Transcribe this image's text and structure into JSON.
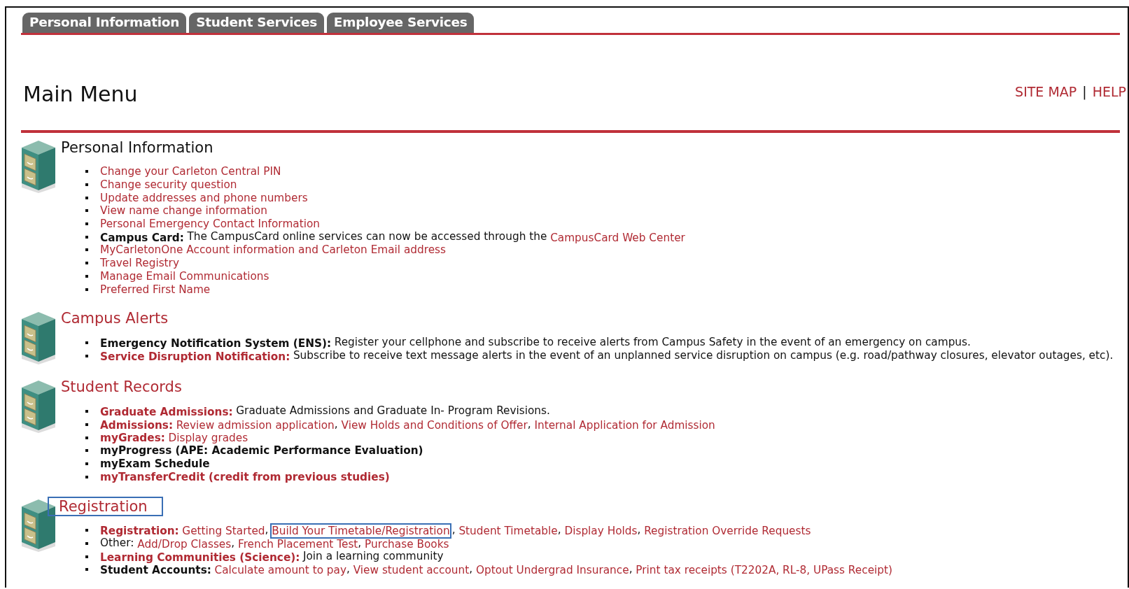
{
  "tabs": [
    {
      "label": "Personal Information"
    },
    {
      "label": "Student Services"
    },
    {
      "label": "Employee Services"
    }
  ],
  "page_title": "Main Menu",
  "header_links": [
    {
      "label": "SITE MAP"
    },
    {
      "label": "HELP"
    }
  ],
  "header_separator": "|",
  "sections": [
    {
      "title": "Personal Information",
      "is_link": false,
      "highlighted": false,
      "items": [
        [
          {
            "kind": "link",
            "text": "Change your Carleton Central PIN"
          }
        ],
        [
          {
            "kind": "link",
            "text": "Change security question"
          }
        ],
        [
          {
            "kind": "link",
            "text": "Update addresses and phone numbers"
          }
        ],
        [
          {
            "kind": "link",
            "text": "View name change information"
          }
        ],
        [
          {
            "kind": "link",
            "text": "Personal Emergency Contact Information"
          }
        ],
        [
          {
            "kind": "label",
            "text": "Campus Card:"
          },
          {
            "kind": "text",
            "text": "The CampusCard online services can now be accessed through the "
          },
          {
            "kind": "link",
            "text": "CampusCard Web Center"
          }
        ],
        [
          {
            "kind": "link",
            "text": "MyCarletonOne Account information and Carleton Email address"
          }
        ],
        [
          {
            "kind": "link",
            "text": "Travel Registry"
          }
        ],
        [
          {
            "kind": "link",
            "text": "Manage Email Communications"
          }
        ],
        [
          {
            "kind": "link",
            "text": "Preferred First Name"
          }
        ]
      ]
    },
    {
      "title": "Campus Alerts",
      "is_link": true,
      "highlighted": false,
      "items": [
        [
          {
            "kind": "label",
            "text": "Emergency Notification System (ENS):"
          },
          {
            "kind": "text",
            "text": "Register your cellphone and subscribe to receive alerts from Campus Safety in the event of an emergency on campus."
          }
        ],
        [
          {
            "kind": "label-link",
            "text": "Service Disruption Notification:"
          },
          {
            "kind": "text",
            "text": "Subscribe to receive text message alerts in the event of an unplanned service disruption on campus (e.g. road/pathway closures, elevator outages, etc)."
          }
        ]
      ]
    },
    {
      "title": "Student Records",
      "is_link": true,
      "highlighted": false,
      "items": [
        [
          {
            "kind": "label-link",
            "text": "Graduate Admissions:"
          },
          {
            "kind": "text",
            "text": "Graduate Admissions and Graduate In- Program Revisions."
          }
        ],
        [
          {
            "kind": "label-link",
            "text": "Admissions:"
          },
          {
            "kind": "link",
            "text": "Review admission application"
          },
          {
            "kind": "text",
            "text": ", "
          },
          {
            "kind": "link",
            "text": "View Holds and Conditions of Offer"
          },
          {
            "kind": "text",
            "text": ", "
          },
          {
            "kind": "link",
            "text": "Internal Application for Admission"
          }
        ],
        [
          {
            "kind": "label-link",
            "text": "myGrades:"
          },
          {
            "kind": "link",
            "text": "Display grades"
          }
        ],
        [
          {
            "kind": "label",
            "text": "myProgress (APE: Academic Performance Evaluation)"
          }
        ],
        [
          {
            "kind": "label",
            "text": "myExam Schedule"
          }
        ],
        [
          {
            "kind": "label-link",
            "text": "myTransferCredit (credit from previous studies)"
          }
        ]
      ]
    },
    {
      "title": "Registration",
      "is_link": true,
      "highlighted": true,
      "items": [
        [
          {
            "kind": "label-link",
            "text": "Registration:"
          },
          {
            "kind": "link",
            "text": "Getting Started"
          },
          {
            "kind": "text",
            "text": ", "
          },
          {
            "kind": "link",
            "text": "Build Your Timetable/Registration",
            "highlighted": true
          },
          {
            "kind": "text",
            "text": ", "
          },
          {
            "kind": "link",
            "text": "Student Timetable"
          },
          {
            "kind": "text",
            "text": ", "
          },
          {
            "kind": "link",
            "text": "Display Holds"
          },
          {
            "kind": "text",
            "text": ", "
          },
          {
            "kind": "link",
            "text": "Registration Override Requests"
          }
        ],
        [
          {
            "kind": "text",
            "text": "Other: "
          },
          {
            "kind": "link",
            "text": "Add/Drop Classes"
          },
          {
            "kind": "text",
            "text": ", "
          },
          {
            "kind": "link",
            "text": "French Placement Test"
          },
          {
            "kind": "text",
            "text": ", "
          },
          {
            "kind": "link",
            "text": "Purchase Books"
          }
        ],
        [
          {
            "kind": "label-link",
            "text": "Learning Communities (Science):"
          },
          {
            "kind": "text",
            "text": "Join a learning community"
          }
        ],
        [
          {
            "kind": "label",
            "text": "Student Accounts:"
          },
          {
            "kind": "link",
            "text": "Calculate amount to pay"
          },
          {
            "kind": "text",
            "text": ", "
          },
          {
            "kind": "link",
            "text": "View student account"
          },
          {
            "kind": "text",
            "text": ", "
          },
          {
            "kind": "link",
            "text": "Optout Undergrad Insurance"
          },
          {
            "kind": "text",
            "text": ", "
          },
          {
            "kind": "link",
            "text": "Print tax receipts (T2202A, RL-8, UPass Receipt)"
          }
        ]
      ]
    }
  ]
}
